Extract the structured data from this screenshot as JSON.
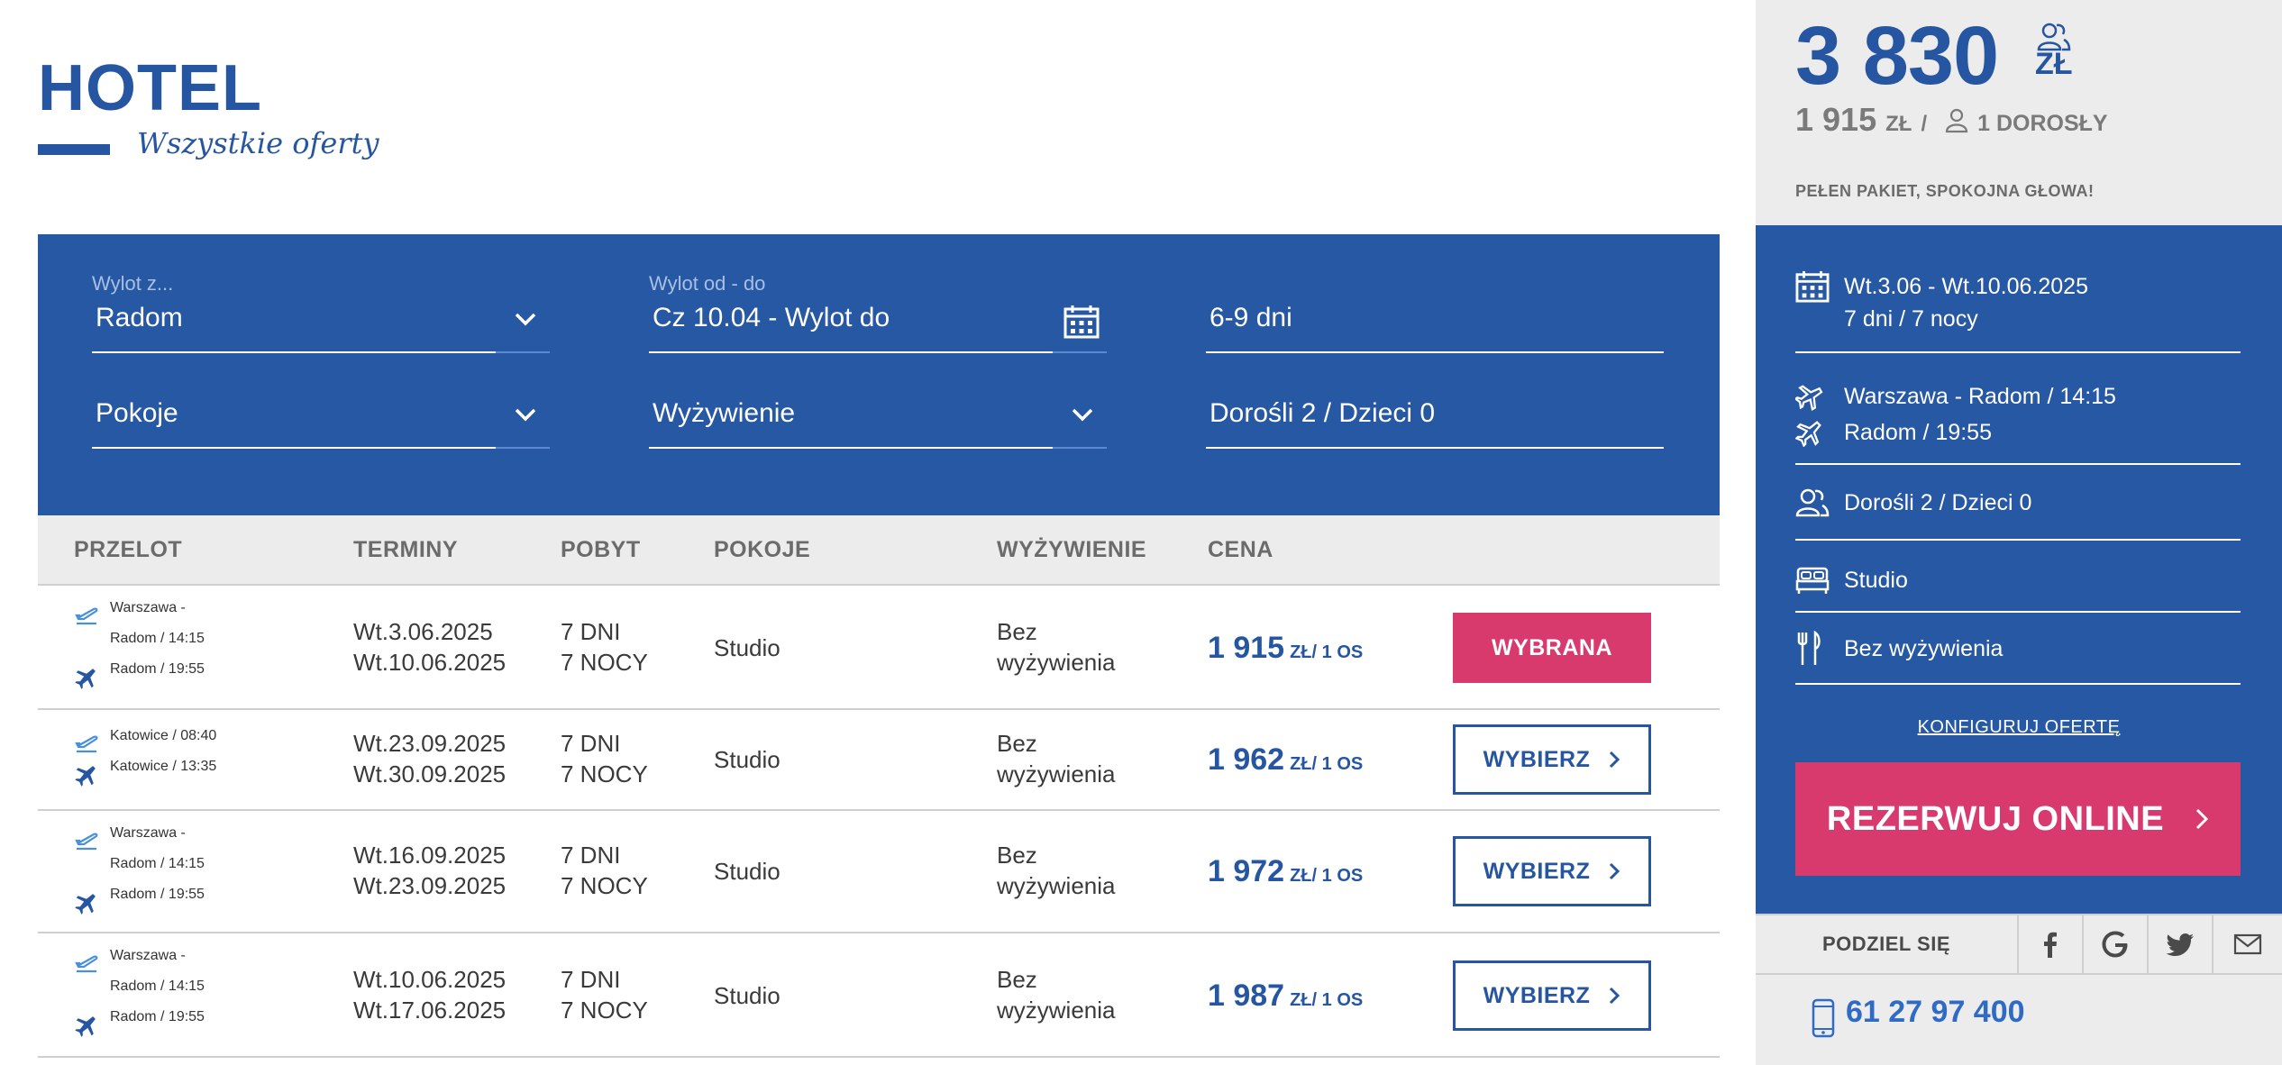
{
  "header": {
    "title": "HOTEL",
    "subtitle": "Wszystkie oferty"
  },
  "filters": {
    "departure_from": {
      "label": "Wylot z...",
      "value": "Radom"
    },
    "departure_dates": {
      "label": "Wylot od - do",
      "value": "Cz 10.04 - Wylot do"
    },
    "duration": {
      "value": "6-9 dni"
    },
    "rooms": {
      "value": "Pokoje"
    },
    "board": {
      "value": "Wyżywienie"
    },
    "people": {
      "value": "Dorośli 2 / Dzieci 0"
    }
  },
  "table": {
    "columns": [
      "PRZELOT",
      "TERMINY",
      "POBYT",
      "POKOJE",
      "WYŻYWIENIE",
      "CENA"
    ],
    "rows": [
      {
        "flight_out": [
          "Warszawa -",
          "Radom / 14:15"
        ],
        "flight_back": "Radom / 19:55",
        "date_from": "Wt.3.06.2025",
        "date_to": "Wt.10.06.2025",
        "days": "7 DNI",
        "nights": "7 NOCY",
        "room": "Studio",
        "board_1": "Bez",
        "board_2": "wyżywienia",
        "price": "1 915",
        "price_unit": "ZŁ/ 1 OS",
        "action": "WYBRANA"
      },
      {
        "flight_out": [
          "Katowice / 08:40"
        ],
        "flight_back": "Katowice / 13:35",
        "date_from": "Wt.23.09.2025",
        "date_to": "Wt.30.09.2025",
        "days": "7 DNI",
        "nights": "7 NOCY",
        "room": "Studio",
        "board_1": "Bez",
        "board_2": "wyżywienia",
        "price": "1 962",
        "price_unit": "ZŁ/ 1 OS",
        "action": "WYBIERZ"
      },
      {
        "flight_out": [
          "Warszawa -",
          "Radom / 14:15"
        ],
        "flight_back": "Radom / 19:55",
        "date_from": "Wt.16.09.2025",
        "date_to": "Wt.23.09.2025",
        "days": "7 DNI",
        "nights": "7 NOCY",
        "room": "Studio",
        "board_1": "Bez",
        "board_2": "wyżywienia",
        "price": "1 972",
        "price_unit": "ZŁ/ 1 OS",
        "action": "WYBIERZ"
      },
      {
        "flight_out": [
          "Warszawa -",
          "Radom / 14:15"
        ],
        "flight_back": "Radom / 19:55",
        "date_from": "Wt.10.06.2025",
        "date_to": "Wt.17.06.2025",
        "days": "7 DNI",
        "nights": "7 NOCY",
        "room": "Studio",
        "board_1": "Bez",
        "board_2": "wyżywienia",
        "price": "1 987",
        "price_unit": "ZŁ/ 1 OS",
        "action": "WYBIERZ"
      }
    ]
  },
  "sidebar": {
    "total_price": "3 830",
    "currency": "ZŁ",
    "per_person_price": "1 915",
    "per_person_currency": "ZŁ",
    "per_person_label": "1 DOROSŁY",
    "tagline": "PEŁEN PAKIET, SPOKOJNA GŁOWA!",
    "dates": "Wt.3.06 - Wt.10.06.2025",
    "stay": "7 dni / 7 nocy",
    "flight_out": "Warszawa - Radom / 14:15",
    "flight_back": "Radom / 19:55",
    "people": "Dorośli 2 / Dzieci 0",
    "room": "Studio",
    "board": "Bez wyżywienia",
    "configure_link": "KONFIGURUJ OFERTĘ",
    "reserve_button": "REZERWUJ ONLINE",
    "share_label": "PODZIEL SIĘ",
    "phone": "61 27 97 400"
  },
  "icons": {
    "departure": "plane-departure-icon",
    "arrival": "plane-arrival-icon",
    "calendar": "calendar-icon",
    "people": "people-icon",
    "bed": "bed-icon",
    "cutlery": "cutlery-icon",
    "facebook": "facebook-icon",
    "google": "google-icon",
    "twitter": "twitter-icon",
    "mail": "mail-icon",
    "phone": "phone-icon"
  },
  "colors": {
    "brand_blue": "#2656a1",
    "panel_blue": "#2758a3",
    "accent_pink": "#d93a6e",
    "light_gray": "#ececec"
  }
}
